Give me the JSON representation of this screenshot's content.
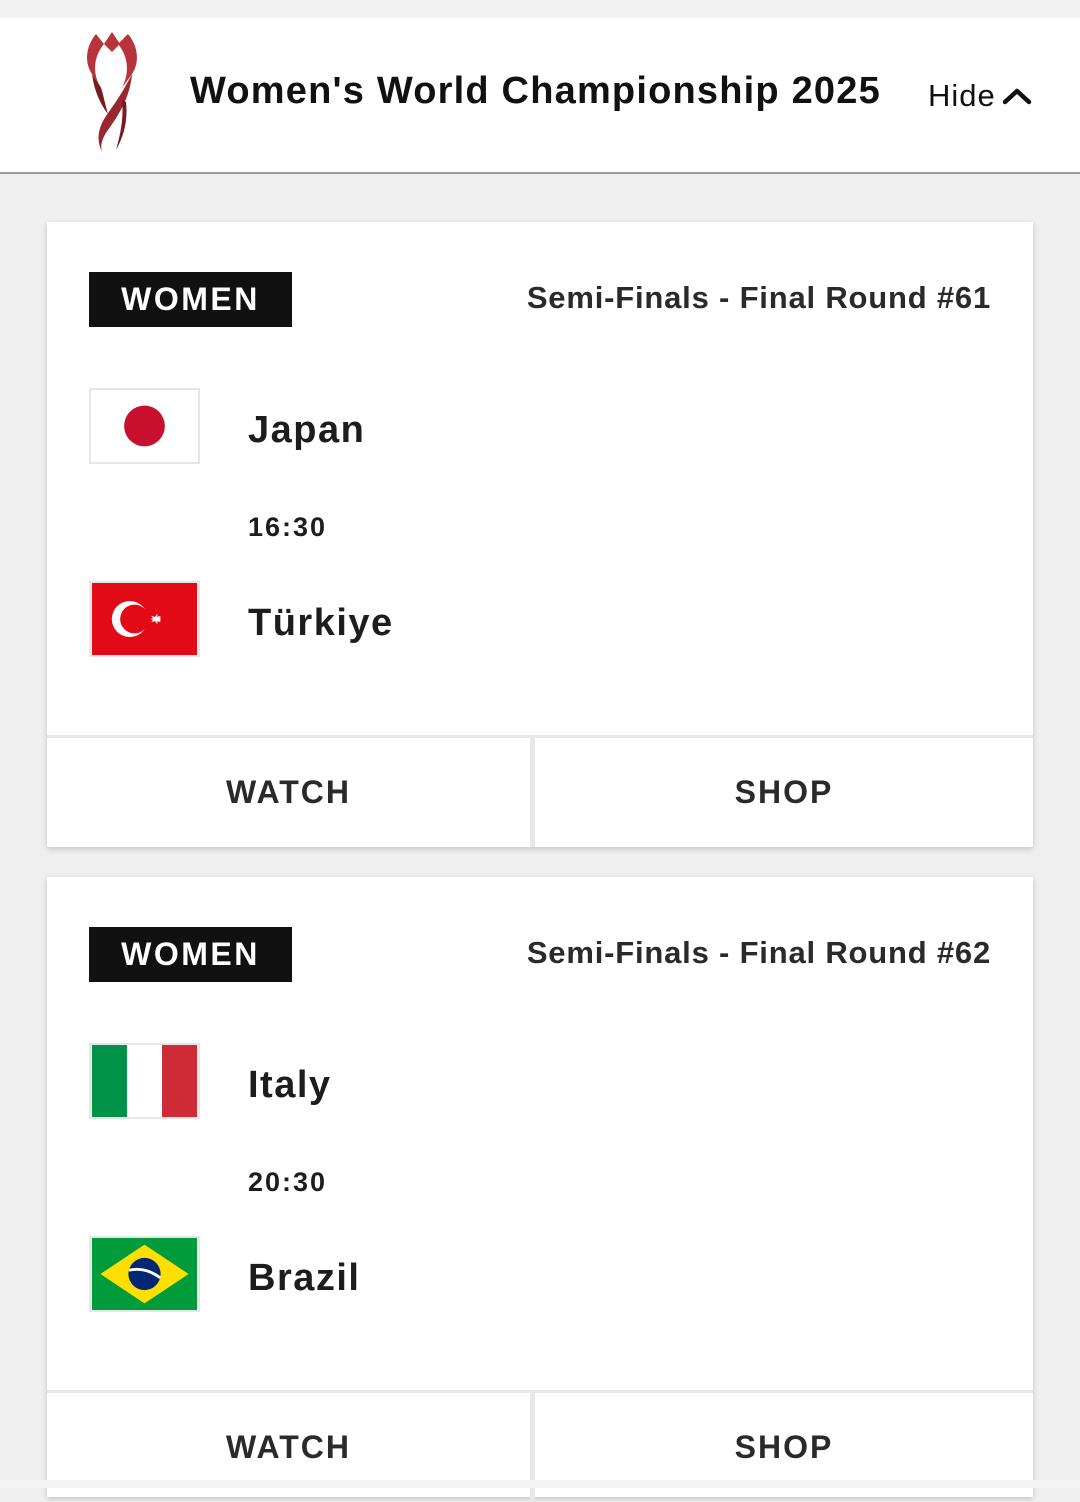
{
  "header": {
    "title": "Women's World Championship 2025",
    "hide_label": "Hide",
    "logo_colors": [
      "#b8333a",
      "#7a1a22"
    ]
  },
  "matches": [
    {
      "category": "WOMEN",
      "round": "Semi-Finals - Final Round #61",
      "team1": {
        "name": "Japan",
        "flag": "japan-flag"
      },
      "time": "16:30",
      "team2": {
        "name": "Türkiye",
        "flag": "turkiye-flag"
      },
      "watch_label": "WATCH",
      "shop_label": "SHOP"
    },
    {
      "category": "WOMEN",
      "round": "Semi-Finals - Final Round #62",
      "team1": {
        "name": "Italy",
        "flag": "italy-flag"
      },
      "time": "20:30",
      "team2": {
        "name": "Brazil",
        "flag": "brazil-flag"
      },
      "watch_label": "WATCH",
      "shop_label": "SHOP"
    }
  ]
}
